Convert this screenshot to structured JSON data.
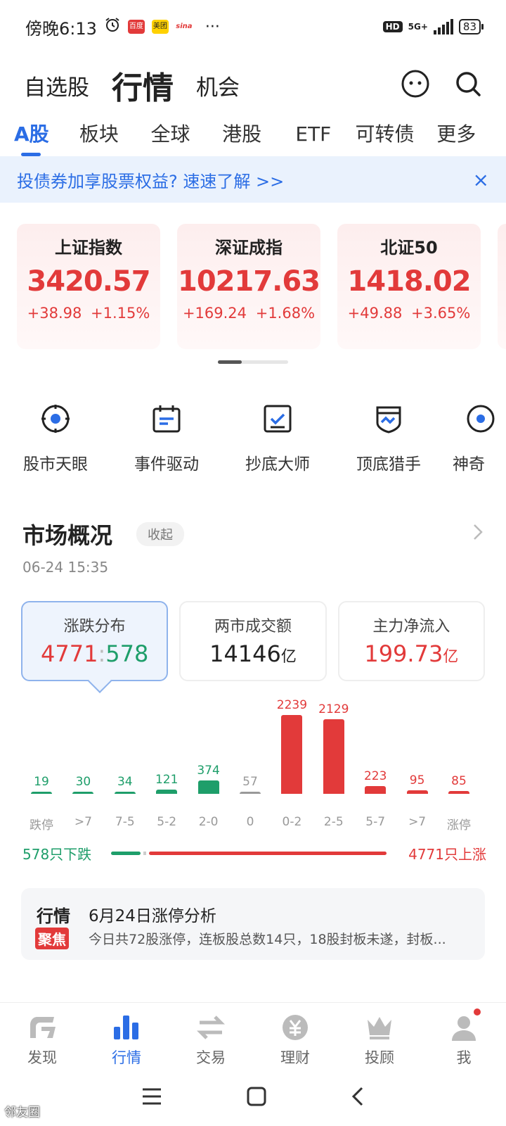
{
  "status": {
    "time": "傍晚6:13",
    "notif_apps": [
      "百度",
      "美团",
      "sina"
    ],
    "more": "···",
    "hd": "HD",
    "network": "5G+",
    "battery": "83"
  },
  "header": {
    "nav": [
      "自选股",
      "行情",
      "机会"
    ],
    "active": "行情"
  },
  "market_tabs": [
    "A股",
    "板块",
    "全球",
    "港股",
    "ETF",
    "可转债",
    "更多"
  ],
  "banner": {
    "text": "投债券加享股票权益? 速速了解 >>",
    "close": "×"
  },
  "indices": [
    {
      "name": "上证指数",
      "value": "3420.57",
      "change": "+38.98",
      "percent": "+1.15%"
    },
    {
      "name": "深证成指",
      "value": "10217.63",
      "change": "+169.24",
      "percent": "+1.68%"
    },
    {
      "name": "北证50",
      "value": "1418.02",
      "change": "+49.88",
      "percent": "+3.65%"
    }
  ],
  "tools": [
    "股市天眼",
    "事件驱动",
    "抄底大师",
    "顶底猎手",
    "神奇"
  ],
  "overview": {
    "title": "市场概况",
    "collapse": "收起",
    "time": "06-24 15:35",
    "stats": [
      {
        "label": "涨跌分布",
        "up": "4771",
        "sep": ":",
        "down": "578"
      },
      {
        "label": "两市成交额",
        "value": "14146",
        "unit": "亿"
      },
      {
        "label": "主力净流入",
        "value": "199.73",
        "unit": "亿"
      }
    ],
    "down_label": "578只下跌",
    "up_label": "4771只上涨"
  },
  "chart_data": {
    "type": "bar",
    "categories": [
      "跌停",
      ">7",
      "7-5",
      "5-2",
      "2-0",
      "0",
      "0-2",
      "2-5",
      "5-7",
      ">7",
      "涨停"
    ],
    "values": [
      19,
      30,
      34,
      121,
      374,
      57,
      2239,
      2129,
      223,
      95,
      85
    ],
    "bar_colors": [
      "#1e9e6a",
      "#1e9e6a",
      "#1e9e6a",
      "#1e9e6a",
      "#1e9e6a",
      "#999999",
      "#e23a3a",
      "#e23a3a",
      "#e23a3a",
      "#e23a3a",
      "#e23a3a"
    ],
    "title": "",
    "xlabel": "",
    "ylabel": ""
  },
  "news": {
    "badge_top": "行情",
    "badge_bottom": "聚焦",
    "title": "6月24日涨停分析",
    "summary": "今日共72股涨停，连板股总数14只，18股封板未遂，封板..."
  },
  "bottom_nav": [
    "发现",
    "行情",
    "交易",
    "理财",
    "投顾",
    "我"
  ],
  "watermark": "邻友圈",
  "colors": {
    "accent": "#2b6de5",
    "up": "#e23a3a",
    "down": "#1e9e6a"
  }
}
